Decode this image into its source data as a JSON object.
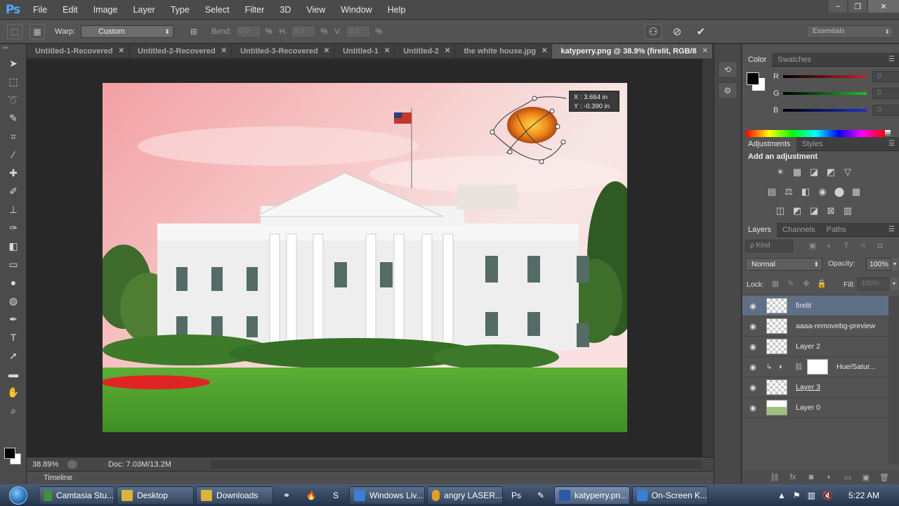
{
  "app": {
    "logo": "Ps",
    "menu": [
      "File",
      "Edit",
      "Image",
      "Layer",
      "Type",
      "Select",
      "Filter",
      "3D",
      "View",
      "Window",
      "Help"
    ]
  },
  "window_controls": {
    "minimize": "–",
    "restore": "❐",
    "close": "✕"
  },
  "options_bar": {
    "warp_label": "Warp:",
    "warp_value": "Custom",
    "bend_label": "Bend:",
    "bend_value": "0.0",
    "h_label": "H:",
    "h_value": "0.0",
    "v_label": "V:",
    "v_value": "0.0",
    "percent": "%",
    "workspace": "Essentials"
  },
  "tabs": [
    {
      "label": "Untitled-1-Recovered",
      "close": "✕"
    },
    {
      "label": "Untitled-2-Recovered",
      "close": "✕"
    },
    {
      "label": "Untitled-3-Recovered",
      "close": "✕"
    },
    {
      "label": "Untitled-1",
      "close": "✕"
    },
    {
      "label": "Untitled-2",
      "close": "✕"
    },
    {
      "label": "the white house.jpg",
      "close": "✕"
    },
    {
      "label": "katyperry.png @ 38.9% (firelit, RGB/8",
      "close": "✕"
    }
  ],
  "tabs_overflow": "»",
  "transform_readout": {
    "x": "X :   3.664 in",
    "y": "Y :  -0.390 in"
  },
  "status_bar": {
    "zoom": "38.89%",
    "doc": "Doc: 7.03M/13.2M",
    "arrow": "▶"
  },
  "timeline": "Timeline",
  "color_panel": {
    "tabs": [
      "Color",
      "Swatches"
    ],
    "channels": [
      {
        "label": "R",
        "value": "0",
        "color": "#d11f1f"
      },
      {
        "label": "G",
        "value": "0",
        "color": "#1fbf2a"
      },
      {
        "label": "B",
        "value": "0",
        "color": "#1f2fd1"
      }
    ]
  },
  "adjustments_panel": {
    "tabs": [
      "Adjustments",
      "Styles"
    ],
    "title": "Add an adjustment",
    "row1": [
      "☀",
      "▦",
      "◪",
      "◩",
      "▽"
    ],
    "row2": [
      "▤",
      "⚖",
      "◧",
      "◉",
      "⬤",
      "▦"
    ],
    "row3": [
      "◫",
      "◩",
      "◪",
      "⊠",
      "▥"
    ]
  },
  "layers_panel": {
    "tabs": [
      "Layers",
      "Channels",
      "Paths"
    ],
    "filter": "ρ Kind",
    "filter_icons": [
      "▣",
      "◐",
      "T",
      "⌗",
      "◘"
    ],
    "blend_mode": "Normal",
    "opacity_label": "Opacity:",
    "opacity_value": "100%",
    "lock_label": "Lock:",
    "lock_icons": [
      "▦",
      "✎",
      "✥",
      "🔒"
    ],
    "fill_label": "Fill:",
    "fill_value": "100%",
    "layers": [
      {
        "name": "firelit",
        "selected": true,
        "thumb": "checker"
      },
      {
        "name": "aaaa-removebg-preview",
        "selected": false,
        "thumb": "checker"
      },
      {
        "name": "Layer 2",
        "selected": false,
        "thumb": "checker"
      },
      {
        "name": "Hue/Satur...",
        "selected": false,
        "thumb": "adjustment"
      },
      {
        "name": "Layer 3",
        "selected": false,
        "thumb": "checker",
        "underline": true
      },
      {
        "name": "Layer 0",
        "selected": false,
        "thumb": "grass"
      }
    ],
    "footer_icons": [
      "⛓",
      "fx",
      "◙",
      "◐",
      "▭",
      "▣",
      "🗑"
    ]
  },
  "taskbar": {
    "buttons": [
      {
        "label": "Camtasia Stu...",
        "color": "#3f8f3f"
      },
      {
        "label": "Desktop",
        "color": "#d9b33a"
      },
      {
        "label": "Downloads",
        "color": "#d9b33a"
      },
      {
        "label": "Windows Liv...",
        "color": "#3a7fd9"
      },
      {
        "label": "angry LASER...",
        "color": "#e0a020"
      },
      {
        "label": "katyperry.pn...",
        "color": "#2a5aa8"
      },
      {
        "label": "On-Screen K...",
        "color": "#3a7fd9"
      }
    ],
    "clock": "5:22 AM"
  },
  "colors": {
    "accent": "#4fa8ff",
    "selected_layer": "#5f6f86",
    "app_bg": "#535353"
  }
}
